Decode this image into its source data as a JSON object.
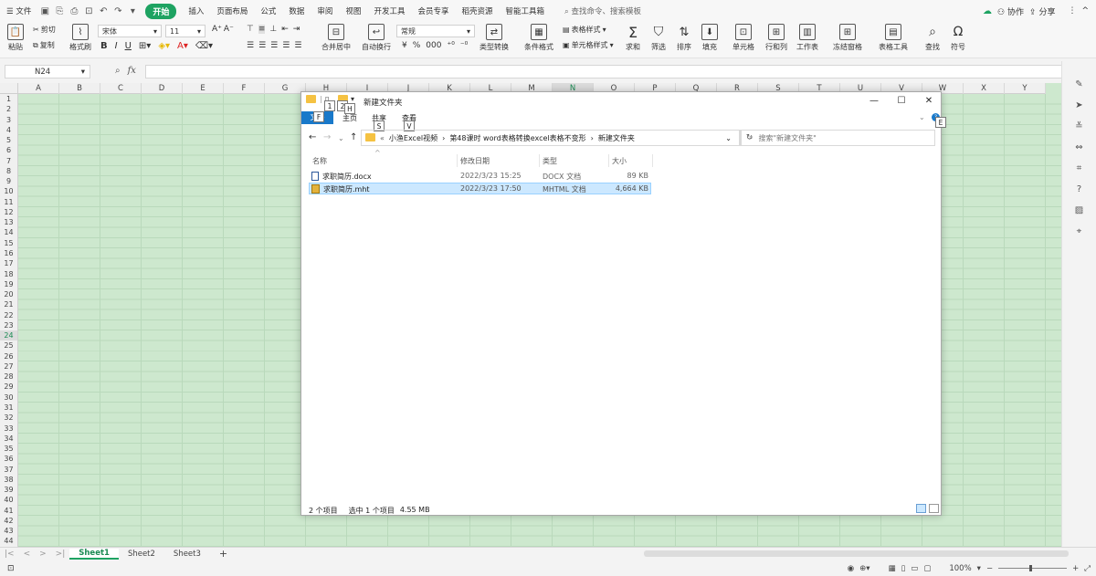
{
  "menubar": {
    "file_label": "文件",
    "start_label": "开始",
    "tabs": [
      "插入",
      "页面布局",
      "公式",
      "数据",
      "审阅",
      "视图",
      "开发工具",
      "会员专享",
      "稻壳资源",
      "智能工具箱"
    ],
    "search_label": "查找命令、搜索模板",
    "collab_label": "协作",
    "share_label": "分享"
  },
  "ribbon": {
    "cut": "剪切",
    "paste": "粘贴",
    "copy": "复制",
    "format_painter": "格式刷",
    "font_name": "宋体",
    "font_size": "11",
    "bold": "B",
    "italic": "I",
    "underline": "U",
    "merge_center": "合并居中",
    "wrap_text": "自动换行",
    "number_format": "常规",
    "currency": "¥",
    "percent": "%",
    "thousands": "000",
    "type_convert": "类型转换",
    "cond_format": "条件格式",
    "table_style": "表格样式",
    "cell_style": "单元格样式",
    "sum": "求和",
    "filter": "筛选",
    "sort": "排序",
    "fill": "填充",
    "cell": "单元格",
    "row_col": "行和列",
    "worksheet": "工作表",
    "freeze": "冻结窗格",
    "table_tools": "表格工具",
    "find": "查找",
    "symbol": "符号"
  },
  "formula_bar": {
    "name_box": "N24",
    "fx_label": "fx"
  },
  "grid": {
    "columns": [
      "A",
      "B",
      "C",
      "D",
      "E",
      "F",
      "G",
      "H",
      "I",
      "J",
      "K",
      "L",
      "M",
      "N",
      "O",
      "P",
      "Q",
      "R",
      "S",
      "T",
      "U",
      "V",
      "W",
      "X",
      "Y"
    ],
    "active_column": "N",
    "rows": [
      1,
      2,
      3,
      4,
      5,
      6,
      7,
      8,
      9,
      10,
      11,
      12,
      13,
      14,
      15,
      16,
      17,
      18,
      19,
      20,
      21,
      22,
      23,
      24,
      25,
      26,
      27,
      28,
      29,
      30,
      31,
      32,
      33,
      34,
      35,
      36,
      37,
      38,
      39,
      40,
      41,
      42,
      43,
      44
    ],
    "active_row": 24
  },
  "sheets": {
    "tabs": [
      "Sheet1",
      "Sheet2",
      "Sheet3"
    ],
    "active": "Sheet1",
    "add": "+"
  },
  "statusbar": {
    "zoom": "100%"
  },
  "explorer": {
    "title": "新建文件夹",
    "ribbon_file": "文件",
    "ribbon_tabs": [
      "主页",
      "共享",
      "查看"
    ],
    "keytips": {
      "qa1": "1",
      "qa2": "2",
      "file": "F",
      "home": "H",
      "share": "S",
      "view": "V",
      "help": "E"
    },
    "breadcrumb": [
      "小渔Excel视频",
      "第48课时 word表格转换excel表格不变形",
      "新建文件夹"
    ],
    "breadcrumb_prefix": "«",
    "search_placeholder": "搜索\"新建文件夹\"",
    "columns": {
      "name": "名称",
      "date": "修改日期",
      "type": "类型",
      "size": "大小"
    },
    "files": [
      {
        "name": "求职简历.docx",
        "date": "2022/3/23 15:25",
        "type": "DOCX 文档",
        "size": "89 KB",
        "selected": false
      },
      {
        "name": "求职简历.mht",
        "date": "2022/3/23 17:50",
        "type": "MHTML 文档",
        "size": "4,664 KB",
        "selected": true
      }
    ],
    "status": {
      "count": "2 个项目",
      "selected": "选中 1 个项目",
      "size": "4.55 MB"
    }
  }
}
